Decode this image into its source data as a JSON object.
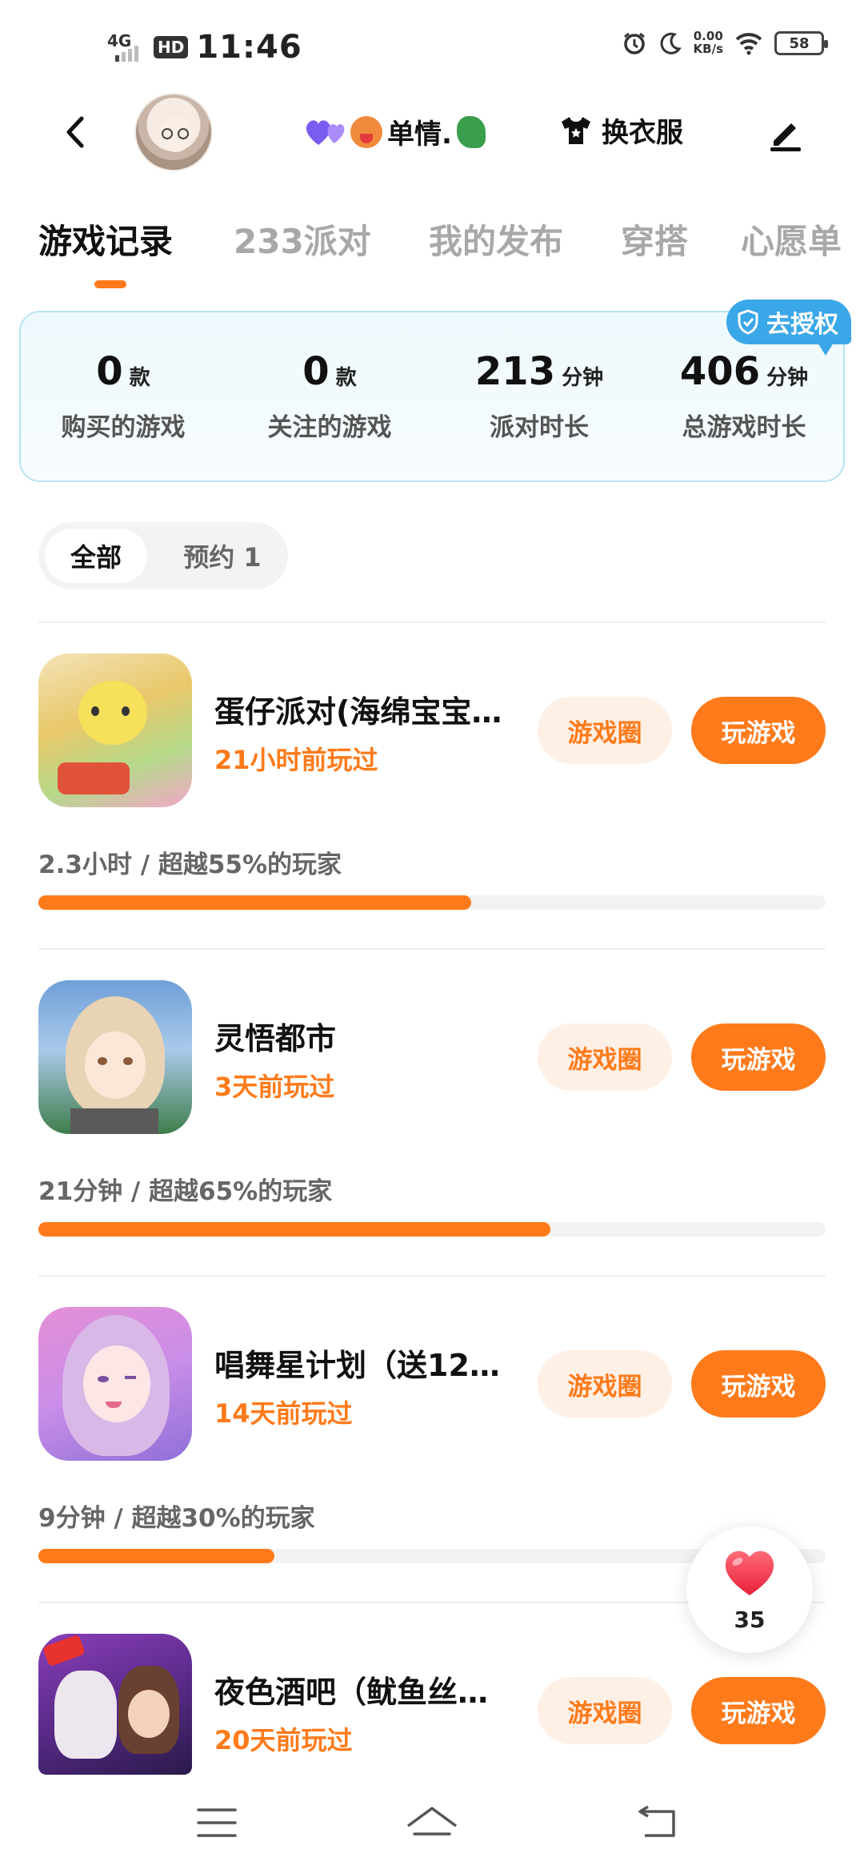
{
  "status_bar": {
    "network": "4G",
    "hd": "HD",
    "time": "11:46",
    "speed_value": "0.00",
    "speed_unit": "KB/s",
    "battery": "58"
  },
  "header": {
    "nickname": "单情.",
    "outfit_label": "换衣服"
  },
  "tabs": [
    {
      "label": "游戏记录",
      "active": true
    },
    {
      "label": "233派对",
      "active": false
    },
    {
      "label": "我的发布",
      "active": false
    },
    {
      "label": "穿搭",
      "active": false
    },
    {
      "label": "心愿单",
      "active": false
    }
  ],
  "stats": {
    "auth_label": "去授权",
    "items": [
      {
        "value": "0",
        "unit": "款",
        "label": "购买的游戏"
      },
      {
        "value": "0",
        "unit": "款",
        "label": "关注的游戏"
      },
      {
        "value": "213",
        "unit": "分钟",
        "label": "派对时长"
      },
      {
        "value": "406",
        "unit": "分钟",
        "label": "总游戏时长"
      }
    ]
  },
  "filter": {
    "all": "全部",
    "reserved": "预约 1"
  },
  "games": [
    {
      "title": "蛋仔派对(海绵宝宝…",
      "last_played": "21小时前玩过",
      "playtime": "2.3小时 / 超越55%的玩家",
      "progress": 0.55,
      "circle_label": "游戏圈",
      "play_label": "玩游戏"
    },
    {
      "title": "灵悟都市",
      "last_played": "3天前玩过",
      "playtime": "21分钟 / 超越65%的玩家",
      "progress": 0.65,
      "circle_label": "游戏圈",
      "play_label": "玩游戏"
    },
    {
      "title": "唱舞星计划（送12…",
      "last_played": "14天前玩过",
      "playtime": "9分钟 / 超越30%的玩家",
      "progress": 0.3,
      "circle_label": "游戏圈",
      "play_label": "玩游戏"
    },
    {
      "title": "夜色酒吧（鱿鱼丝…",
      "last_played": "20天前玩过",
      "circle_label": "游戏圈",
      "play_label": "玩游戏"
    }
  ],
  "like": {
    "count": "35"
  },
  "colors": {
    "accent": "#ff7a1a",
    "auth": "#3aa7e8"
  }
}
